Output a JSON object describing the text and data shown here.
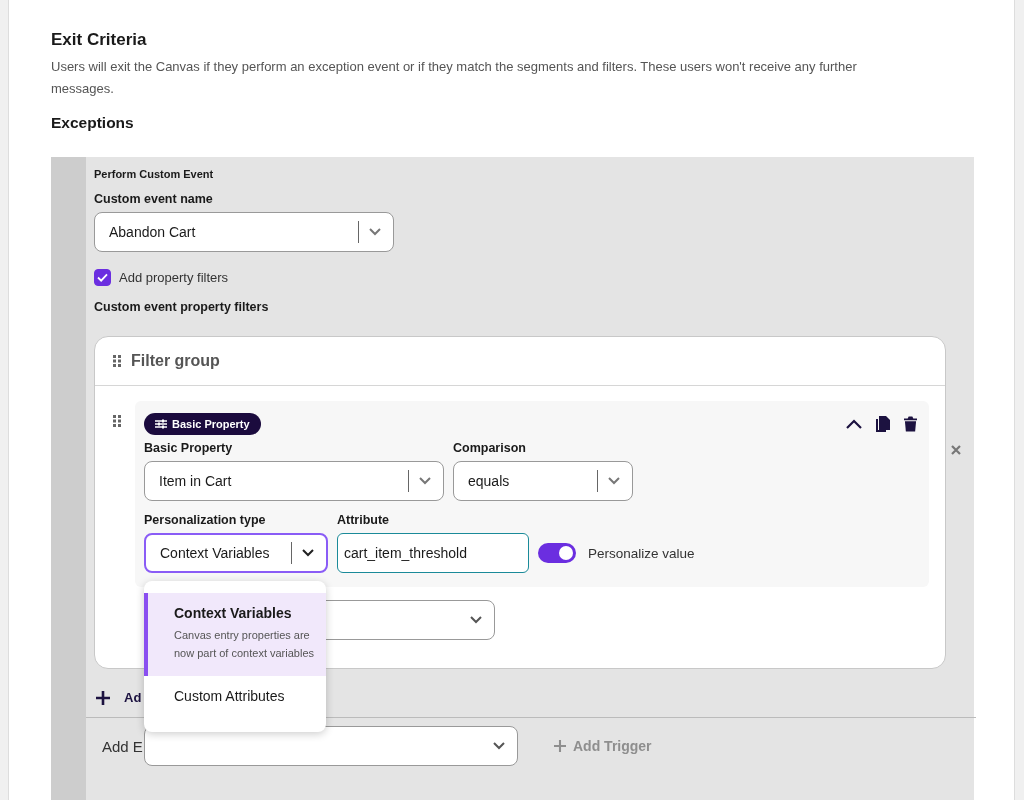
{
  "section": {
    "title": "Exit Criteria",
    "description": "Users will exit the Canvas if they perform an exception event or if they match the segments and filters. These users won't receive any further messages.",
    "subtitle": "Exceptions"
  },
  "exception": {
    "type_label": "Perform Custom Event",
    "event_name": {
      "label": "Custom event name",
      "value": "Abandon Cart"
    },
    "property_filters_checkbox": {
      "label": "Add property filters",
      "checked": true
    },
    "filters_label": "Custom event property filters",
    "filter_group": {
      "title": "Filter group",
      "filters": [
        {
          "badge": "Basic Property",
          "expanded": true,
          "property": {
            "label": "Basic Property",
            "value": "Item in Cart"
          },
          "comparison": {
            "label": "Comparison",
            "value": "equals"
          },
          "personalization_type": {
            "label": "Personalization type",
            "value": "Context Variables"
          },
          "attribute": {
            "label": "Attribute",
            "value": "cart_item_threshold"
          },
          "personalize_toggle": {
            "label": "Personalize value",
            "on": true
          }
        }
      ]
    },
    "add_filter_link": "Ad",
    "personalization_menu": {
      "options": [
        {
          "title": "Context Variables",
          "description": "Canvas entry properties are now part of context variables",
          "selected": true
        },
        {
          "title": "Custom Attributes",
          "selected": false
        }
      ]
    },
    "add_event": {
      "label": "Add E"
    },
    "add_trigger": {
      "label": "Add Trigger",
      "disabled": true
    }
  }
}
